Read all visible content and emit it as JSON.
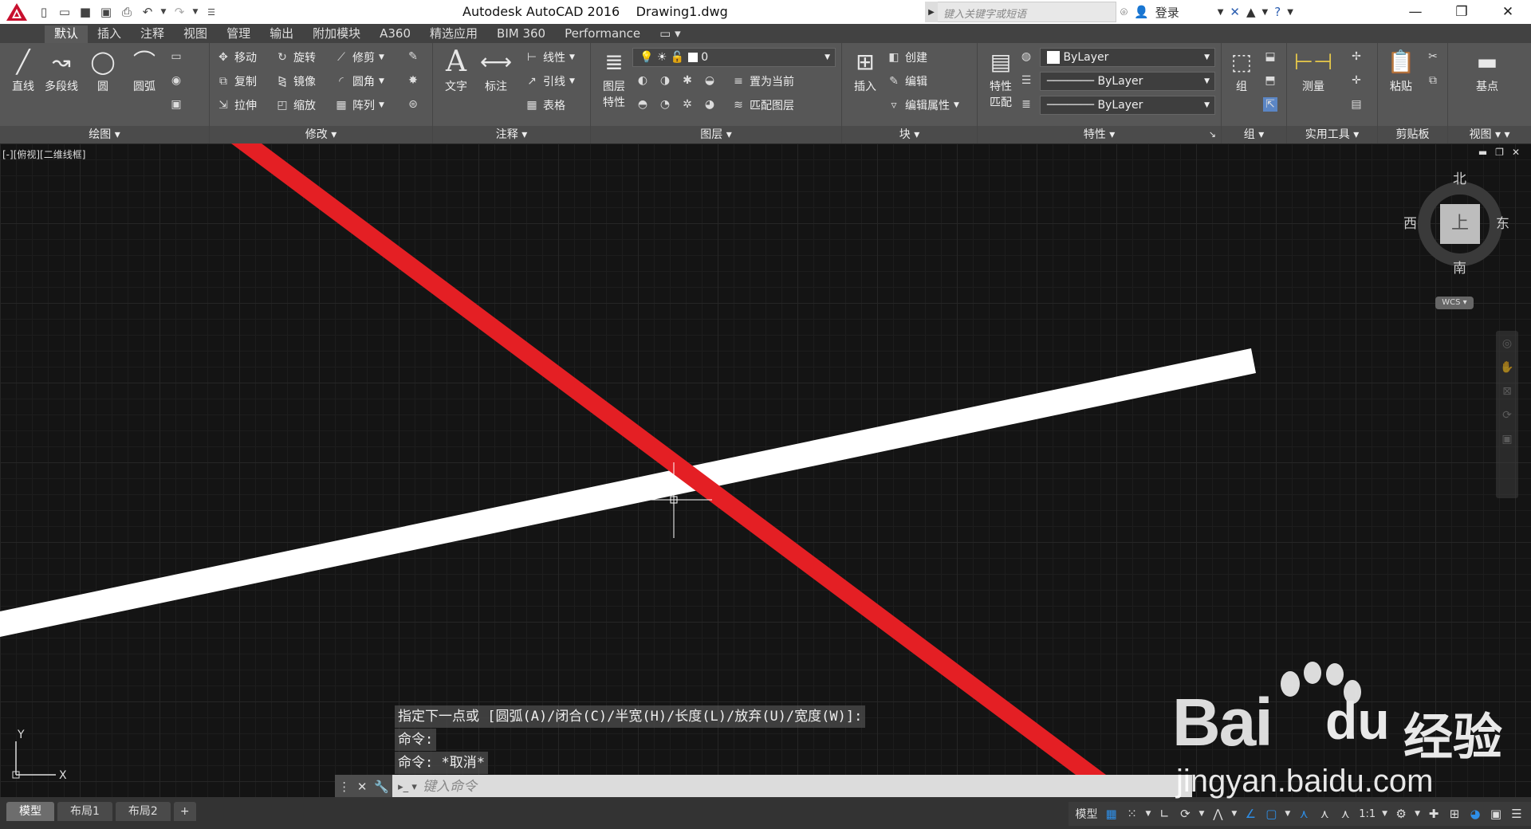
{
  "app": {
    "title": "Autodesk AutoCAD 2016",
    "document": "Drawing1.dwg"
  },
  "search": {
    "placeholder": "键入关键字或短语"
  },
  "account": {
    "login": "登录"
  },
  "tabs": [
    "默认",
    "插入",
    "注释",
    "视图",
    "管理",
    "输出",
    "附加模块",
    "A360",
    "精选应用",
    "BIM 360",
    "Performance"
  ],
  "ribbon": {
    "draw": {
      "title": "绘图",
      "line": "直线",
      "polyline": "多段线",
      "circle": "圆",
      "arc": "圆弧"
    },
    "modify": {
      "title": "修改",
      "move": "移动",
      "rotate": "旋转",
      "trim": "修剪",
      "copy": "复制",
      "mirror": "镜像",
      "fillet": "圆角",
      "stretch": "拉伸",
      "scale": "缩放",
      "array": "阵列"
    },
    "annotation": {
      "title": "注释",
      "text": "文字",
      "dimension": "标注",
      "linear": "线性",
      "leader": "引线",
      "table": "表格"
    },
    "layers": {
      "title": "图层",
      "properties_l1": "图层",
      "properties_l2": "特性",
      "current_layer": "0",
      "make_current": "置为当前",
      "match_layer": "匹配图层"
    },
    "block": {
      "title": "块",
      "insert": "插入",
      "create": "创建",
      "edit": "编辑",
      "edit_attr": "编辑属性"
    },
    "properties": {
      "title": "特性",
      "match_l1": "特性",
      "match_l2": "匹配",
      "color": "ByLayer",
      "linetype": "ByLayer",
      "lineweight": "ByLayer"
    },
    "groups": {
      "title": "组",
      "group": "组"
    },
    "utilities": {
      "title": "实用工具",
      "measure": "测量"
    },
    "clipboard": {
      "title": "剪贴板",
      "paste": "粘贴"
    },
    "view": {
      "title": "视图",
      "base": "基点"
    }
  },
  "viewport": {
    "label": "[-][俯视][二维线框]",
    "bg": "#141414"
  },
  "viewcube": {
    "north": "北",
    "south": "南",
    "east": "东",
    "west": "西",
    "top": "上",
    "wcs": "WCS"
  },
  "ucs": {
    "x": "X",
    "y": "Y"
  },
  "drawing": {
    "red_color": "#e41f24",
    "white_color": "#ffffff"
  },
  "command_history": [
    "指定下一点或 [圆弧(A)/闭合(C)/半宽(H)/长度(L)/放弃(U)/宽度(W)]:",
    "命令:",
    "命令: *取消*"
  ],
  "command": {
    "placeholder": "键入命令"
  },
  "layout_tabs": [
    "模型",
    "布局1",
    "布局2"
  ],
  "status": {
    "model": "模型",
    "scale": "1:1"
  },
  "watermark": {
    "bai": "Bai",
    "du": "du",
    "jingyan": "经验",
    "url": "jingyan.baidu.com"
  }
}
